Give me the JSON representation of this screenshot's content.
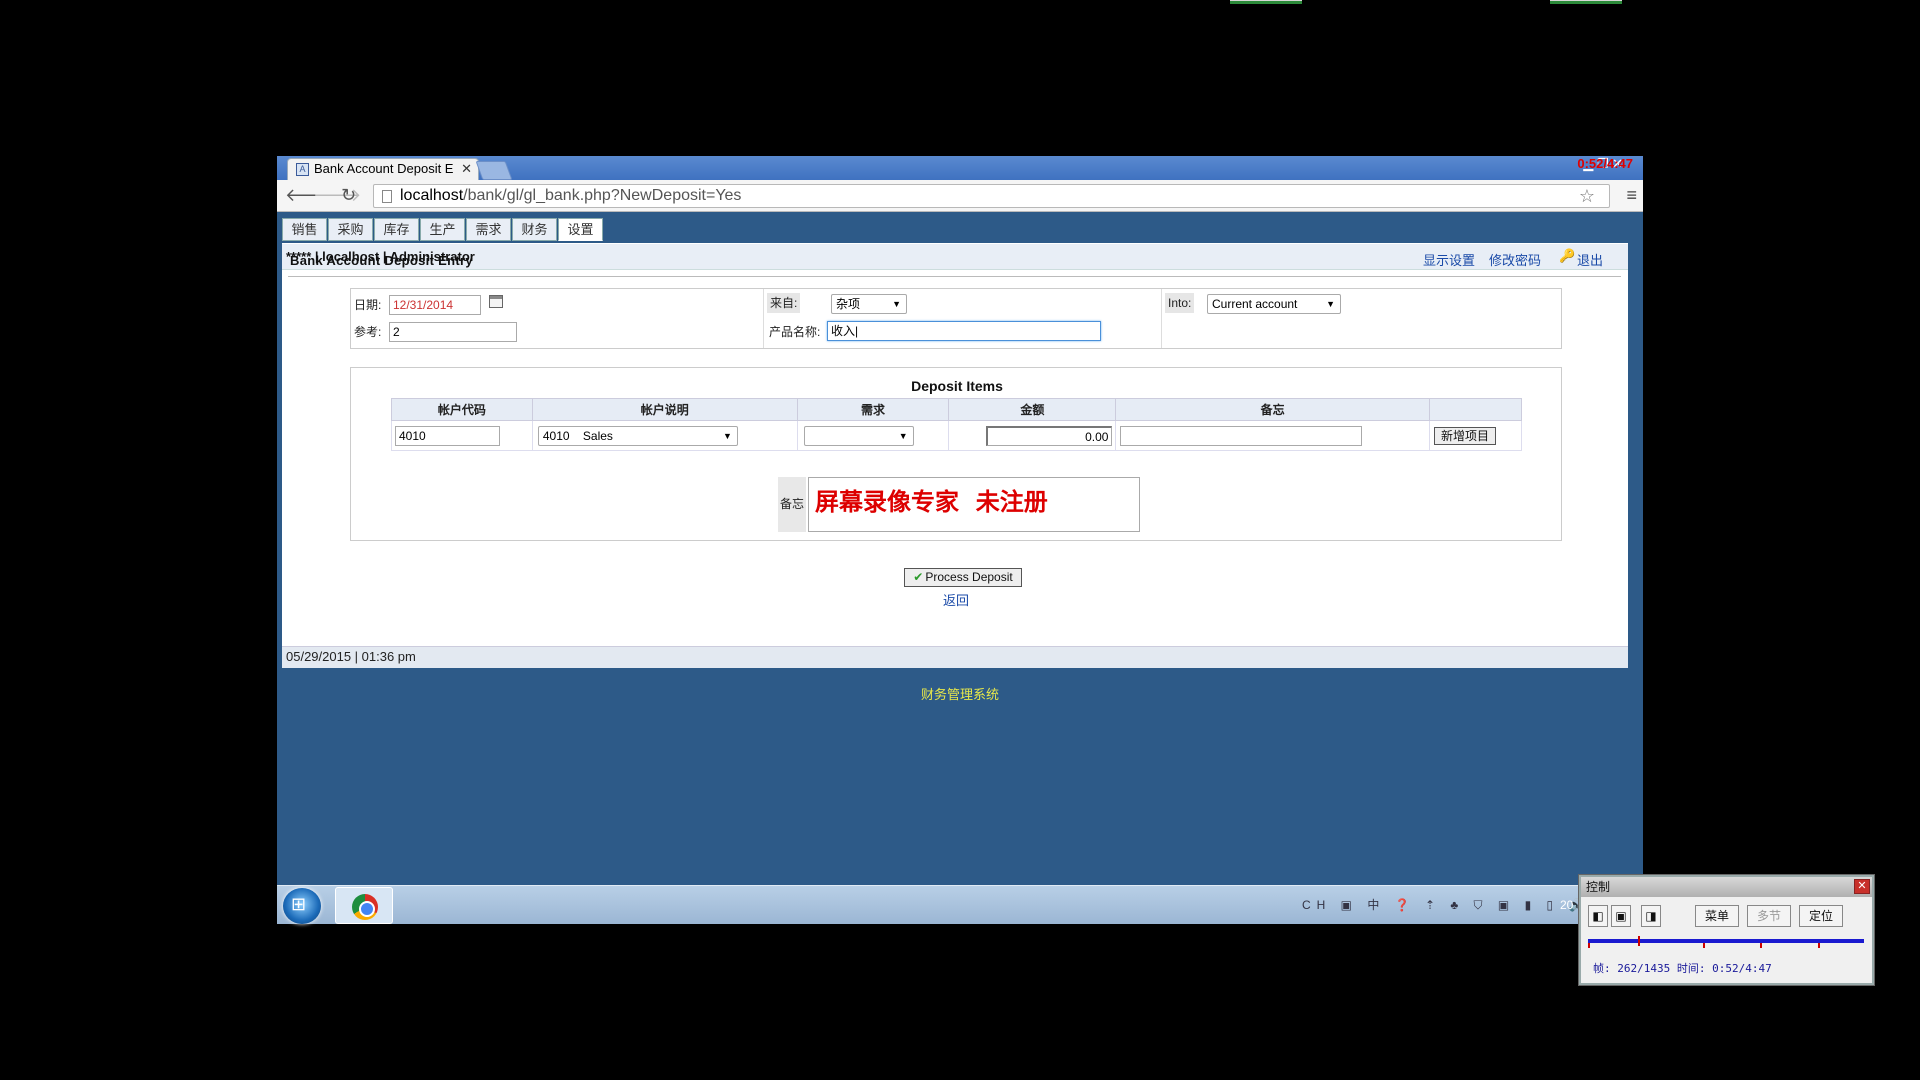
{
  "browser": {
    "tab_title": "Bank Account Deposit E",
    "url_host": "localhost",
    "url_path": "/bank/gl/gl_bank.php?NewDeposit=Yes",
    "recording_timer": "0:52/4:47"
  },
  "app": {
    "tabs": [
      {
        "label": "销售"
      },
      {
        "label": "采购"
      },
      {
        "label": "库存"
      },
      {
        "label": "生产"
      },
      {
        "label": "需求"
      },
      {
        "label": "财务"
      },
      {
        "label": "设置"
      }
    ],
    "active_tab": "设置",
    "user_info": "***** | localhost | Administrator",
    "links": {
      "display_settings": "显示设置",
      "change_password": "修改密码",
      "logout": "退出"
    },
    "page_title": "Bank Account Deposit Entry"
  },
  "header_form": {
    "date_label": "日期:",
    "date_value": "12/31/2014",
    "ref_label": "参考:",
    "ref_value": "2",
    "from_label": "来自:",
    "from_value": "杂项",
    "product_label": "产品名称:",
    "product_value": "收入",
    "into_label": "Into:",
    "into_value": "Current account"
  },
  "deposit_items": {
    "title": "Deposit Items",
    "columns": [
      "帐户代码",
      "帐户说明",
      "需求",
      "金额",
      "备忘"
    ],
    "row": {
      "account_code": "4010",
      "account_desc": "4010    Sales",
      "demand": "",
      "amount": "0.00",
      "memo": ""
    },
    "add_button": "新增项目",
    "memo_label": "备忘",
    "memo_text": "屏幕录像专家  未注册"
  },
  "actions": {
    "process_button": "Process Deposit",
    "back_link": "返回"
  },
  "footer": {
    "datetime": "05/29/2015 | 01:36 pm",
    "system_name": "财务管理系统"
  },
  "taskbar": {
    "tray_text": "CH",
    "clock_partial": "20"
  },
  "control_panel": {
    "title": "控制",
    "buttons": {
      "menu": "菜单",
      "multi": "多节",
      "locate": "定位"
    },
    "frame_text": "帧: 262/1435 时间: 0:52/4:47"
  }
}
